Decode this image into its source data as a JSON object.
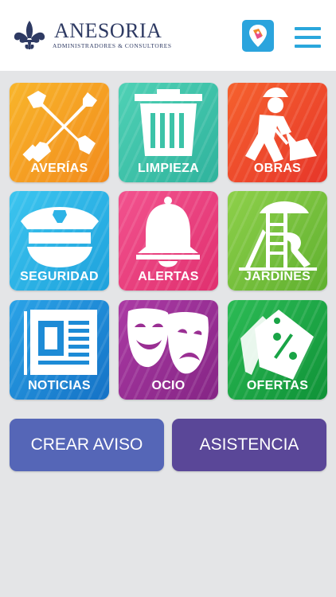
{
  "header": {
    "brand_name": "ANESORIA",
    "brand_subtitle": "ADMINISTRADORES & CONSULTORES",
    "logo_icon": "fleur-de-lis-icon",
    "app_icon": "map-pin-tag-icon",
    "menu_icon": "hamburger-menu-icon"
  },
  "tiles": [
    {
      "label": "AVERÍAS",
      "icon": "wrench-screwdriver-icon",
      "color": "#f6a21f"
    },
    {
      "label": "LIMPIEZA",
      "icon": "trash-bin-icon",
      "color": "#3cc3a8"
    },
    {
      "label": "OBRAS",
      "icon": "construction-worker-icon",
      "color": "#ef4a2c"
    },
    {
      "label": "SEGURIDAD",
      "icon": "police-cap-icon",
      "color": "#2db3e6"
    },
    {
      "label": "ALERTAS",
      "icon": "bell-icon",
      "color": "#ea3f80"
    },
    {
      "label": "JARDINES",
      "icon": "playground-icon",
      "color": "#77c23a"
    },
    {
      "label": "NOTICIAS",
      "icon": "newspaper-icon",
      "color": "#1d8bd6"
    },
    {
      "label": "OCIO",
      "icon": "theater-masks-icon",
      "color": "#9a2f93"
    },
    {
      "label": "OFERTAS",
      "icon": "price-tags-icon",
      "color": "#19a446"
    }
  ],
  "actions": {
    "create": {
      "label": "CREAR AVISO",
      "color": "#5566b7"
    },
    "assist": {
      "label": "ASISTENCIA",
      "color": "#5a4798"
    }
  }
}
